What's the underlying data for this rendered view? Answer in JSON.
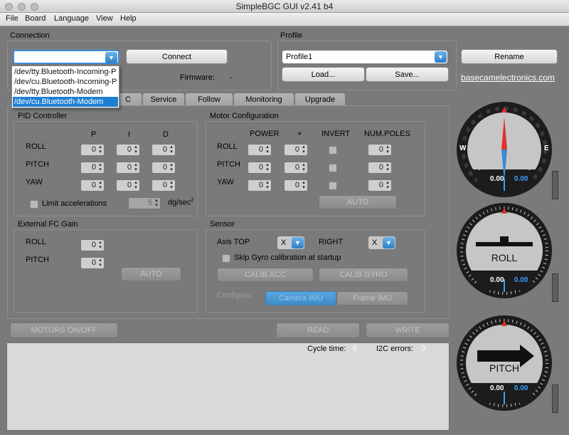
{
  "window": {
    "title": "SimpleBGC GUI v2.41 b4"
  },
  "menu": [
    "File",
    "Board",
    "Language",
    "View",
    "Help"
  ],
  "connection": {
    "title": "Connection",
    "port_value": "",
    "connect_label": "Connect",
    "firmware_label": "Firmware:",
    "firmware_value": "-",
    "dropdown_items": [
      "/dev/tty.Bluetooth-Incoming-P",
      "/dev/cu.Bluetooth-Incoming-P",
      "/dev/tty.Bluetooth-Modem",
      "/dev/cu.Bluetooth-Modem"
    ],
    "dropdown_selected": 3
  },
  "profile": {
    "title": "Profile",
    "selected": "Profile1",
    "rename_label": "Rename",
    "load_label": "Load...",
    "save_label": "Save...",
    "website": "basecamelectronics.com"
  },
  "tabs": [
    "C",
    "Service",
    "Follow",
    "Monitoring",
    "Upgrade"
  ],
  "pid": {
    "title": "PID Controller",
    "headers": [
      "P",
      "I",
      "D"
    ],
    "rows": [
      {
        "label": "ROLL",
        "values": [
          "0",
          "0",
          "0"
        ]
      },
      {
        "label": "PITCH",
        "values": [
          "0",
          "0",
          "0"
        ]
      },
      {
        "label": "YAW",
        "values": [
          "0",
          "0",
          "0"
        ]
      }
    ],
    "limit_label": "Limit accelerations",
    "limit_value": "5",
    "limit_unit": "dg/sec",
    "limit_unit_sup": "2"
  },
  "motor": {
    "title": "Motor Configuration",
    "headers": [
      "POWER",
      "+",
      "INVERT",
      "NUM.POLES"
    ],
    "rows": [
      {
        "label": "ROLL",
        "power": "0",
        "plus": "0",
        "poles": "0"
      },
      {
        "label": "PITCH",
        "power": "0",
        "plus": "0",
        "poles": "0"
      },
      {
        "label": "YAW",
        "power": "0",
        "plus": "0",
        "poles": "0"
      }
    ],
    "auto_label": "AUTO"
  },
  "ext_fc": {
    "title": "External FC Gain",
    "rows": [
      {
        "label": "ROLL",
        "value": "0"
      },
      {
        "label": "PITCH",
        "value": "0"
      }
    ],
    "auto_label": "AUTO"
  },
  "sensor": {
    "title": "Sensor",
    "axis_top_label": "Axis TOP",
    "axis_top_value": "X",
    "right_label": "RIGHT",
    "right_value": "X",
    "skip_gyro_label": "Skip Gyro calibration at startup",
    "calib_acc_label": "CALIB.ACC",
    "calib_gyro_label": "CALIB.GYRO",
    "configure_label": "Configure:",
    "camera_imu_label": "Camera IMU",
    "frame_imu_label": "Frame IMU"
  },
  "bottom": {
    "motors_label": "MOTORS ON/OFF",
    "read_label": "READ",
    "write_label": "WRITE",
    "cycle_time_label": "Cycle time:",
    "cycle_time_value": "0",
    "i2c_label": "I2C errors:",
    "i2c_value": "0"
  },
  "gauges": {
    "yaw": {
      "west": "W",
      "east": "E",
      "left_value": "0.00",
      "right_value": "0.00"
    },
    "roll": {
      "name": "ROLL",
      "left_value": "0.00",
      "right_value": "0.00"
    },
    "pitch": {
      "name": "PITCH",
      "left_value": "0.00",
      "right_value": "0.00"
    }
  },
  "colors": {
    "accent": "#1e7fd1",
    "value_blue": "#3aa0ff",
    "compass_red": "#e0322a"
  }
}
